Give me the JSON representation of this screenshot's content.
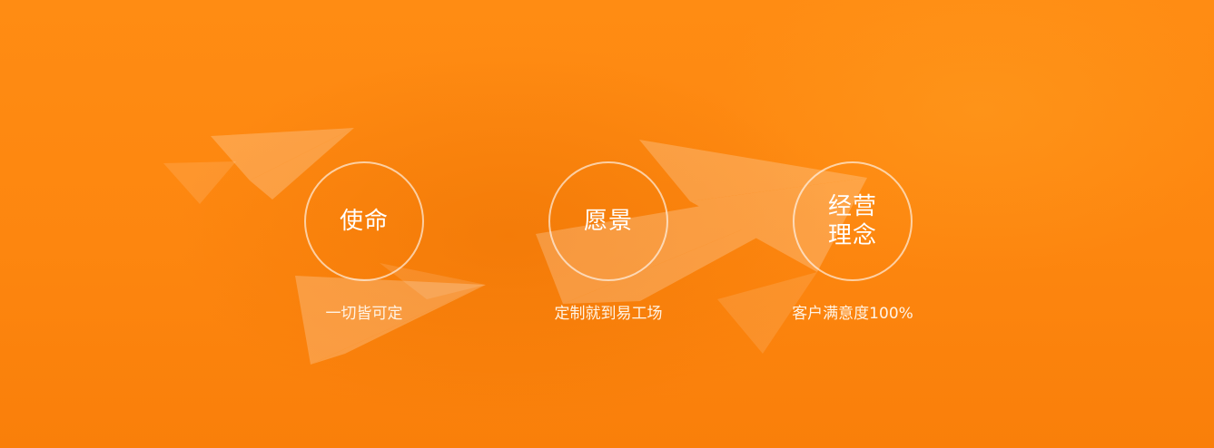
{
  "values": [
    {
      "title": "使命",
      "subtitle": "一切皆可定"
    },
    {
      "title": "愿景",
      "subtitle": "定制就到易工场"
    },
    {
      "title": "经营理念",
      "subtitle": "客户满意度100%"
    }
  ],
  "colors": {
    "background": "#fd860f",
    "circle_border": "#ffffff",
    "text": "#ffffff"
  }
}
